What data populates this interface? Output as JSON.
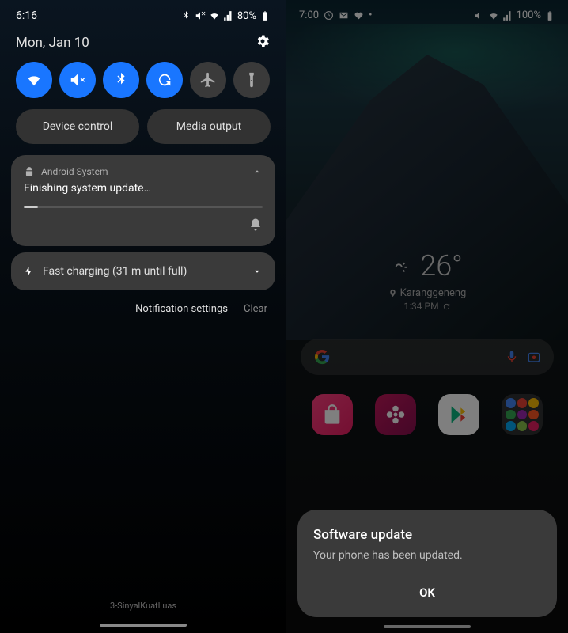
{
  "left": {
    "status": {
      "time": "6:16",
      "battery": "80%"
    },
    "date": "Mon, Jan 10",
    "qs_buttons": {
      "device_control": "Device control",
      "media_output": "Media output"
    },
    "notif": {
      "source": "Android System",
      "title": "Finishing system update…"
    },
    "charging": "Fast charging (31 m until full)",
    "actions": {
      "settings": "Notification settings",
      "clear": "Clear"
    },
    "carrier": "3-SinyalKuatLuas"
  },
  "right": {
    "status": {
      "time": "7:00",
      "battery": "100%"
    },
    "weather": {
      "temp": "26°",
      "location": "Karanggeneng",
      "time": "1:34 PM"
    },
    "dialog": {
      "title": "Software update",
      "body": "Your phone has been updated.",
      "ok": "OK"
    }
  }
}
